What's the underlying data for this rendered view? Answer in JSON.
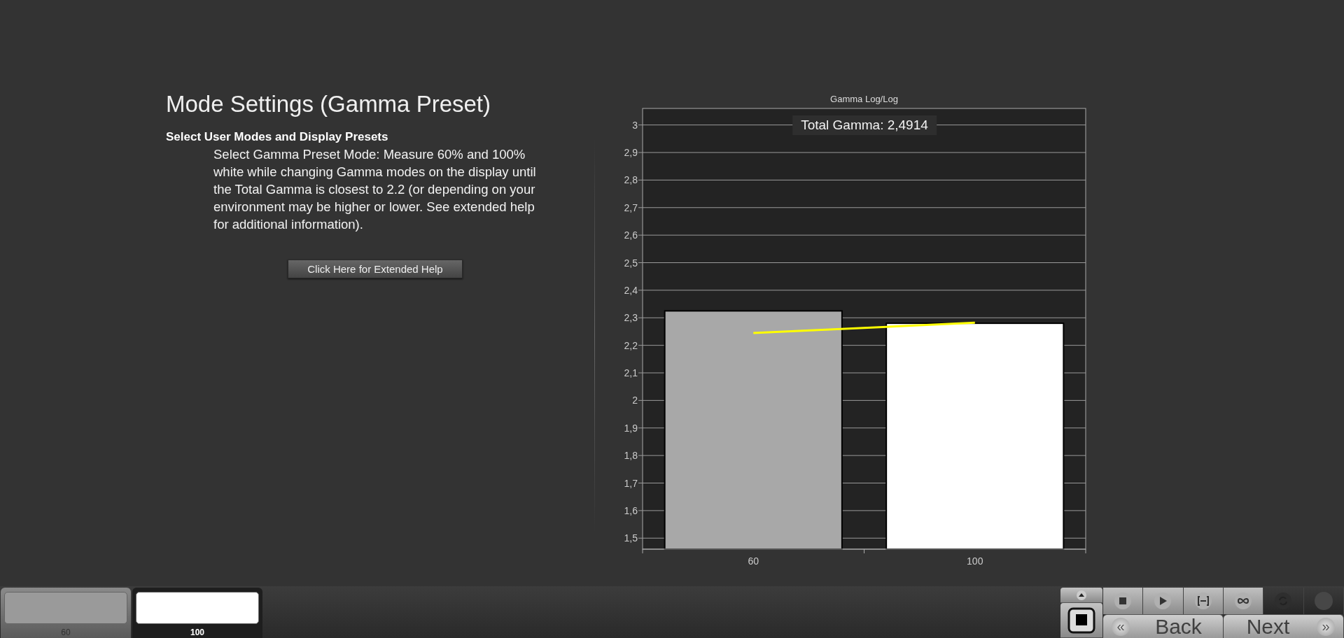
{
  "heading": "Mode Settings (Gamma Preset)",
  "subheading": "Select User Modes and Display Presets",
  "description": "Select Gamma Preset Mode: Measure 60% and 100% white while changing Gamma modes on the display until the Total Gamma is closest to 2.2 (or depending on your environment may be higher or lower. See extended help for additional information).",
  "help_button": "Click Here for Extended Help",
  "chart": {
    "total_label": "Total Gamma: 2,4914",
    "chart_data": {
      "type": "bar",
      "title": "Gamma Log/Log",
      "categories": [
        "60",
        "100"
      ],
      "stacked": true,
      "grid": true,
      "series": [
        {
          "type": "bar",
          "color": "#a8a8a8",
          "values": [
            2.325,
            null
          ]
        },
        {
          "type": "bar",
          "color": "#ffffff",
          "values": [
            null,
            2.28
          ]
        },
        {
          "type": "line",
          "color": "#ffff00",
          "values": [
            2.245,
            2.282
          ]
        }
      ],
      "ylim": [
        1.46,
        3.06
      ],
      "yticks": [
        {
          "value": 1.5,
          "label": "1,5"
        },
        {
          "value": 1.6,
          "label": "1,6"
        },
        {
          "value": 1.7,
          "label": "1,7"
        },
        {
          "value": 1.8,
          "label": "1,8"
        },
        {
          "value": 1.9,
          "label": "1,9"
        },
        {
          "value": 2,
          "label": "2"
        },
        {
          "value": 2.1,
          "label": "2,1"
        },
        {
          "value": 2.2,
          "label": "2,2"
        },
        {
          "value": 2.3,
          "label": "2,3"
        },
        {
          "value": 2.4,
          "label": "2,4"
        },
        {
          "value": 2.5,
          "label": "2,5"
        },
        {
          "value": 2.6,
          "label": "2,6"
        },
        {
          "value": 2.7,
          "label": "2,7"
        },
        {
          "value": 2.8,
          "label": "2,8"
        },
        {
          "value": 2.9,
          "label": "2,9"
        },
        {
          "value": 3,
          "label": "3"
        }
      ]
    }
  },
  "swatches": [
    {
      "label": "60",
      "color": "#9a9a9a",
      "selected": false
    },
    {
      "label": "100",
      "color": "#ffffff",
      "selected": true
    }
  ],
  "toolbar": [
    {
      "disabled": false
    },
    {
      "disabled": false
    },
    {
      "disabled": false
    },
    {
      "disabled": false
    },
    {
      "disabled": true
    },
    {
      "disabled": true
    }
  ],
  "nav": [
    {
      "label": "Back",
      "glyph": "«"
    },
    {
      "label": "Next",
      "glyph": "»"
    }
  ]
}
